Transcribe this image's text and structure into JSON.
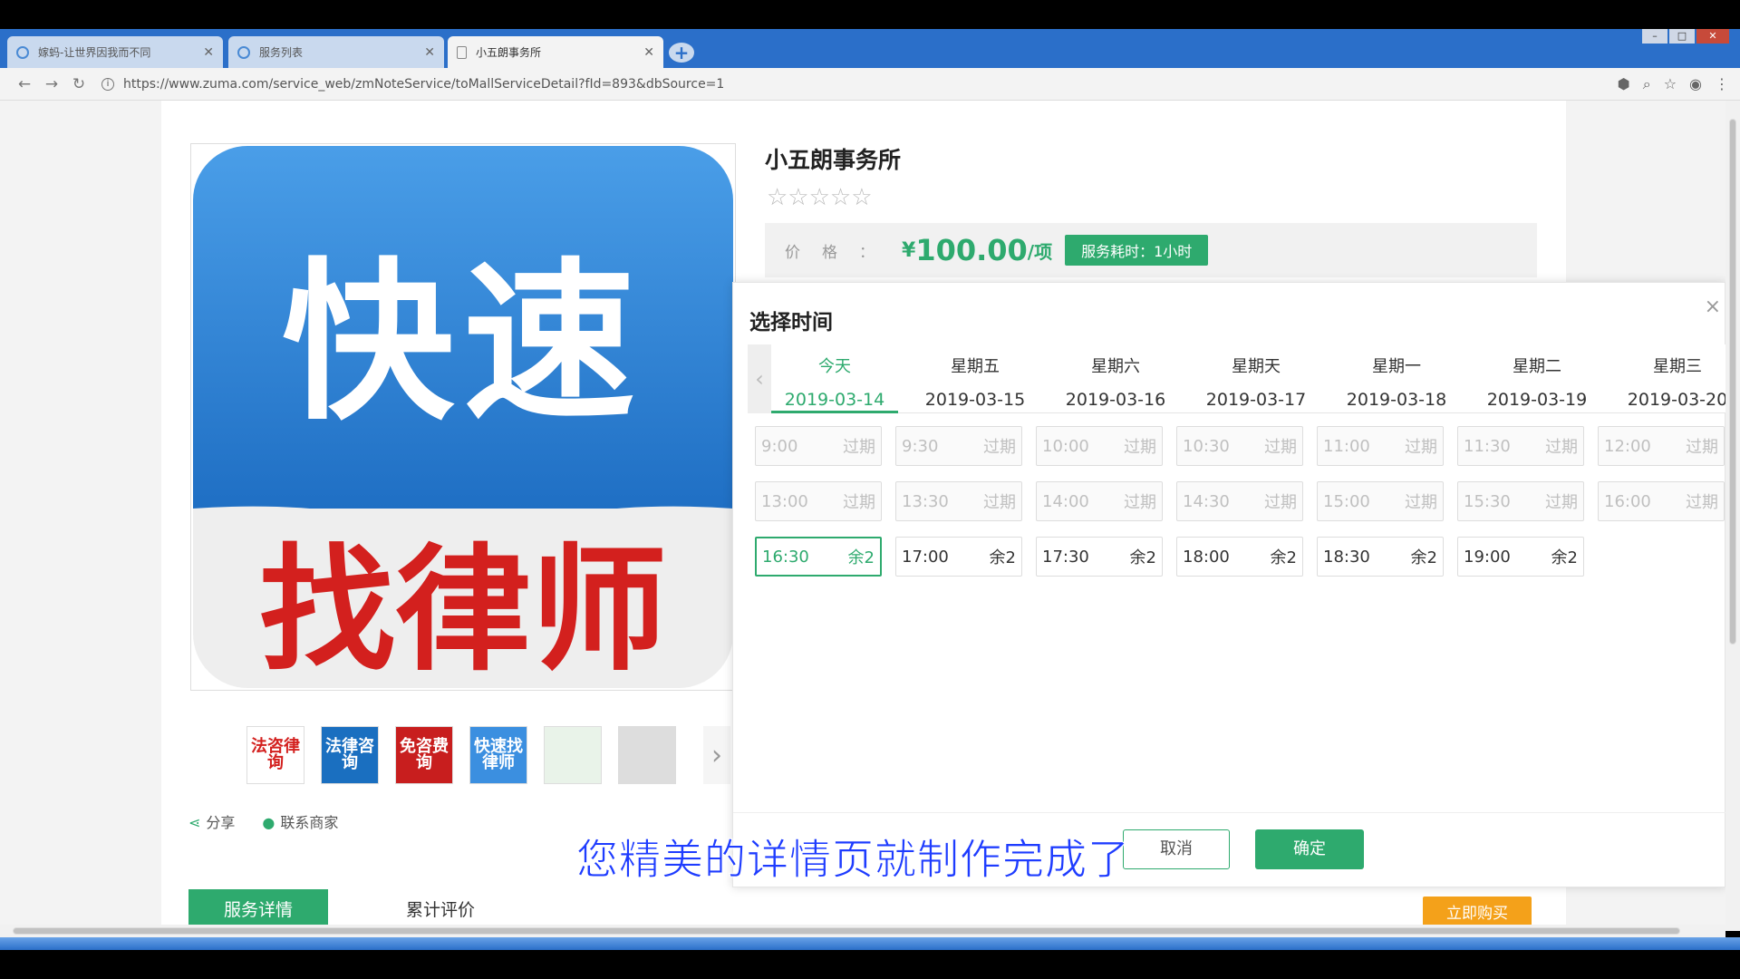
{
  "browser": {
    "tabs": [
      {
        "title": "嫁蚂-让世界因我而不同"
      },
      {
        "title": "服务列表"
      },
      {
        "title": "小五朗事务所"
      }
    ],
    "new_tab": "+",
    "url": "https://www.zuma.com/service_web/zmNoteService/toMallServiceDetail?fId=893&dbSource=1",
    "window_controls": {
      "minimize": "–",
      "maximize": "□",
      "close": "✕"
    }
  },
  "logo": {
    "top_text": "快速",
    "bottom_text": "找律师"
  },
  "thumbnails": [
    {
      "text": "法咨律询",
      "color": "#d3201e",
      "bg": "#fff"
    },
    {
      "text": "法律咨询",
      "color": "#fff",
      "bg": "#1a6fc0"
    },
    {
      "text": "免咨费询",
      "color": "#fff",
      "bg": "#c81e1e"
    },
    {
      "text": "快速找律师",
      "color": "#fff",
      "bg": "#3b8fe0"
    },
    {
      "text": "",
      "color": "#333",
      "bg": "#e9f3e9"
    },
    {
      "text": "",
      "color": "#333",
      "bg": "#ddd"
    }
  ],
  "actions": {
    "share": "分享",
    "contact": "联系商家"
  },
  "tabs": {
    "detail": "服务详情",
    "reviews": "累计评价",
    "buy": "立即购买"
  },
  "shop": {
    "title": "小五朗事务所",
    "stars": "☆☆☆☆☆",
    "price_label": "价格：",
    "price_currency": "¥",
    "price_value": "100.00",
    "price_unit": "/项",
    "service_time": "服务耗时：1小时"
  },
  "dialog": {
    "title": "选择时间",
    "close": "×",
    "prev": "‹",
    "days": [
      {
        "weekday": "今天",
        "date": "2019-03-14",
        "active": true
      },
      {
        "weekday": "星期五",
        "date": "2019-03-15"
      },
      {
        "weekday": "星期六",
        "date": "2019-03-16"
      },
      {
        "weekday": "星期天",
        "date": "2019-03-17"
      },
      {
        "weekday": "星期一",
        "date": "2019-03-18"
      },
      {
        "weekday": "星期二",
        "date": "2019-03-19"
      },
      {
        "weekday": "星期三",
        "date": "2019-03-20"
      }
    ],
    "slots": [
      [
        {
          "time": "9:00",
          "status": "过期"
        },
        {
          "time": "9:30",
          "status": "过期"
        },
        {
          "time": "10:00",
          "status": "过期"
        },
        {
          "time": "10:30",
          "status": "过期"
        },
        {
          "time": "11:00",
          "status": "过期"
        },
        {
          "time": "11:30",
          "status": "过期"
        },
        {
          "time": "12:00",
          "status": "过期"
        }
      ],
      [
        {
          "time": "13:00",
          "status": "过期"
        },
        {
          "time": "13:30",
          "status": "过期"
        },
        {
          "time": "14:00",
          "status": "过期"
        },
        {
          "time": "14:30",
          "status": "过期"
        },
        {
          "time": "15:00",
          "status": "过期"
        },
        {
          "time": "15:30",
          "status": "过期"
        },
        {
          "time": "16:00",
          "status": "过期"
        }
      ],
      [
        {
          "time": "16:30",
          "status": "余2",
          "selected": true
        },
        {
          "time": "17:00",
          "status": "余2"
        },
        {
          "time": "17:30",
          "status": "余2"
        },
        {
          "time": "18:00",
          "status": "余2"
        },
        {
          "time": "18:30",
          "status": "余2"
        },
        {
          "time": "19:00",
          "status": "余2"
        }
      ]
    ],
    "cancel": "取消",
    "confirm": "确定"
  },
  "caption": "您精美的详情页就制作完成了"
}
